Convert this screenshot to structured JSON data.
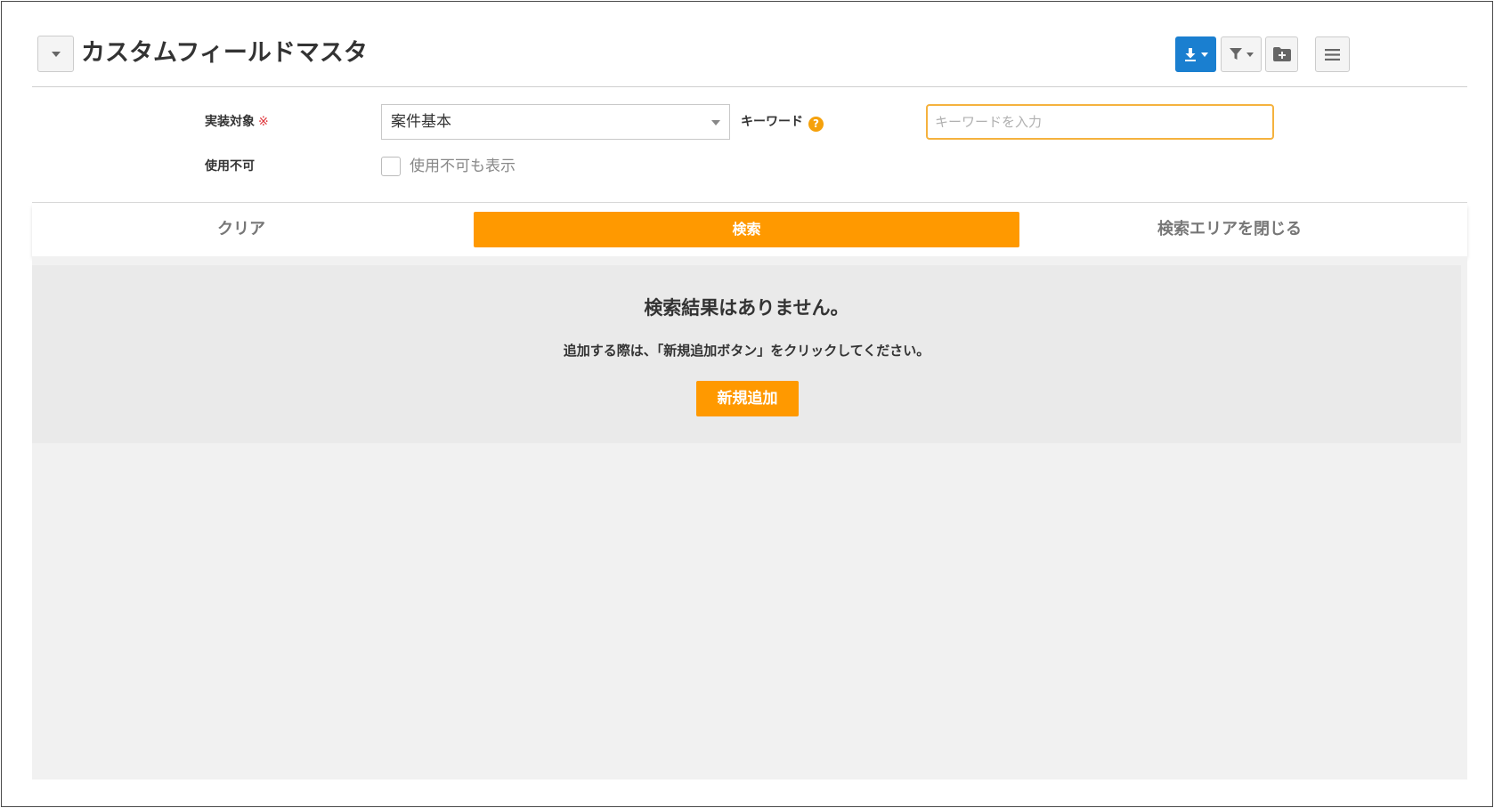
{
  "header": {
    "title": "カスタムフィールドマスタ",
    "icons": {
      "collapse": "chevron-down-icon",
      "download": "download-icon",
      "filter": "filter-icon",
      "folder_add": "folder-add-icon",
      "menu": "hamburger-menu-icon"
    }
  },
  "search": {
    "target_label": "実装対象",
    "required_mark": "※",
    "target_value": "案件基本",
    "keyword_label": "キーワード",
    "keyword_help": "?",
    "keyword_placeholder": "キーワードを入力",
    "disabled_label": "使用不可",
    "disabled_checkbox_label": "使用不可も表示"
  },
  "actions": {
    "clear_label": "クリア",
    "search_label": "検索",
    "close_label": "検索エリアを閉じる"
  },
  "results": {
    "empty_title": "検索結果はありません。",
    "empty_message": "追加する際は、「新規追加ボタン」をクリックしてください。",
    "add_label": "新規追加"
  },
  "colors": {
    "accent": "#ff9900",
    "primary": "#1a7fd0",
    "required": "#e0393e",
    "help": "#f5a10b"
  }
}
